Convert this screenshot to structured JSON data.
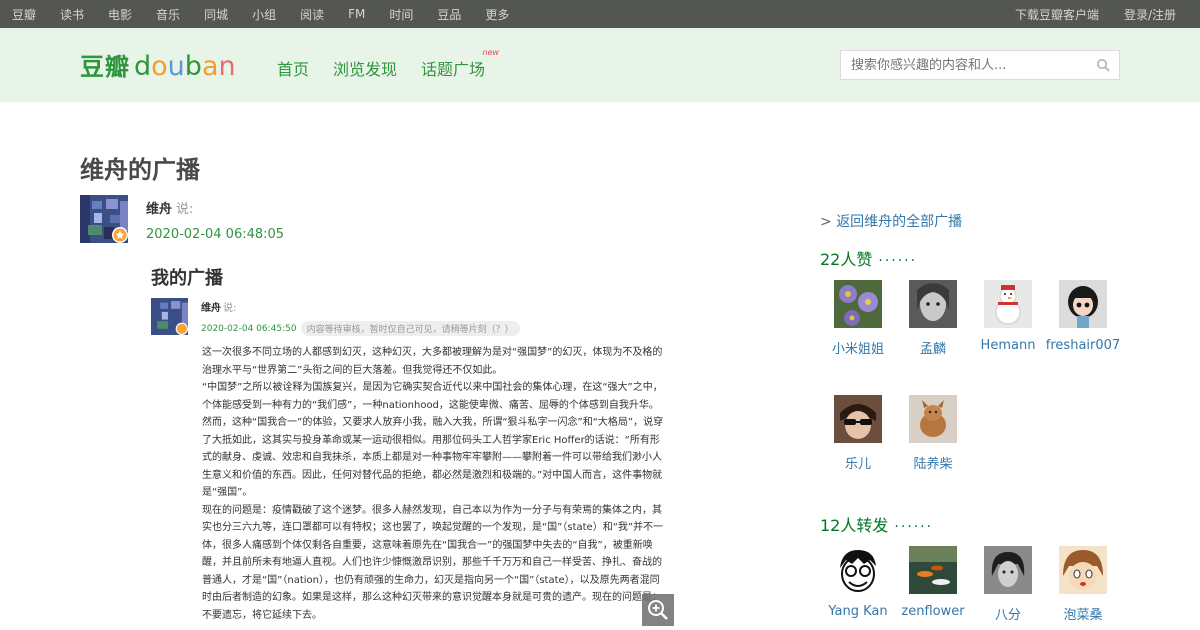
{
  "topbar": {
    "items": [
      "豆瓣",
      "读书",
      "电影",
      "音乐",
      "同城",
      "小组",
      "阅读",
      "FM",
      "时间",
      "豆品",
      "更多"
    ],
    "download": "下载豆瓣客户端",
    "login": "登录/注册"
  },
  "header": {
    "logo_cn": "豆瓣",
    "logo_en": [
      "d",
      "o",
      "u",
      "b",
      "a",
      "n"
    ],
    "nav": [
      "首页",
      "浏览发现",
      "话题广场"
    ],
    "new_badge": "new",
    "search_placeholder": "搜索你感兴趣的内容和人..."
  },
  "main": {
    "page_title": "维舟的广播",
    "author": "维舟",
    "says": "说:",
    "timestamp": "2020-02-04 06:48:05"
  },
  "shot": {
    "title": "我的广播",
    "author": "维舟",
    "says": "说:",
    "timestamp": "2020-02-04 06:45:50",
    "notice": "内容等待审核，暂时仅自己可见，请稍等片刻（？）",
    "paragraphs": [
      "这一次很多不同立场的人都感到幻灭，这种幻灭，大多都被理解为是对“强国梦”的幻灭，体现为不及格的治理水平与“世界第二”头衔之间的巨大落差。但我觉得还不仅如此。",
      "“中国梦”之所以被诠释为国族复兴，是因为它确实契合近代以来中国社会的集体心理，在这“强大”之中，个体能感受到一种有力的“我们感”，一种nationhood，这能使卑微、痛苦、屈辱的个体感到自我升华。然而，这种“国我合一”的体验，又要求人放弃小我，融入大我，所谓“狠斗私字一闪念”和“大格局”，说穿了大抵如此，这其实与投身革命或某一运动很相似。用那位码头工人哲学家Eric Hoffer的话说：“所有形式的献身、虔诚、效忠和自我抹杀，本质上都是对一种事物牢牢攀附——攀附着一件可以带给我们渺小人生意义和价值的东西。因此，任何对替代品的拒绝，都必然是激烈和极端的。”对中国人而言，这件事物就是“强国”。",
      "现在的问题是：疫情戳破了这个迷梦。很多人赫然发现，自己本以为作为一分子与有荣焉的集体之内，其实也分三六九等，连口罩都可以有特权；这也罢了，唤起觉醒的一个发现，是“国”（state）和“我”并不一体，很多人痛感到个体仅剩各自重要，这意味着原先在“国我合一”的强国梦中失去的“自我”，被重新唤醒，并且前所未有地逼人直视。人们也许少慷慨激昂识别，那些千千万万和自己一样受苦、挣扎、奋战的普通人，才是“国”（nation），也仍有顽强的生命力，幻灭是指向另一个“国”（state），以及原先两者混同时由后者制造的幻象。如果是这样，那么这种幻灭带来的意识觉醒本身就是可贵的遗产。现在的问题是：不要遗忘，将它延续下去。"
    ]
  },
  "sidebar": {
    "back_link": "返回维舟的全部广播",
    "likes_title": "22人赞",
    "likes": [
      {
        "name": "小米姐姐",
        "pic": "purple-flowers"
      },
      {
        "name": "孟麟",
        "pic": "bw-portrait"
      },
      {
        "name": "Hemann",
        "pic": "snowman"
      },
      {
        "name": "freshair007",
        "pic": "doll"
      },
      {
        "name": "乐儿",
        "pic": "sunglasses-person"
      },
      {
        "name": "陆养柴",
        "pic": "dog"
      }
    ],
    "reshares_title": "12人转发",
    "reshares": [
      {
        "name": "Yang Kan",
        "pic": "cartoon-face"
      },
      {
        "name": "zenflower",
        "pic": "koi-pond"
      },
      {
        "name": "八分",
        "pic": "bw-portrait"
      },
      {
        "name": "泡菜桑",
        "pic": "manga-girl"
      }
    ],
    "dots": "······"
  },
  "colors": {
    "topbar_bg": "#545652",
    "header_bg": "#e9f4e9",
    "douban_green": "#2e963d",
    "link_blue": "#3377aa",
    "heading_green": "#007722"
  },
  "icons": [
    "search-icon",
    "zoom-in-icon",
    "verified-badge-icon"
  ]
}
